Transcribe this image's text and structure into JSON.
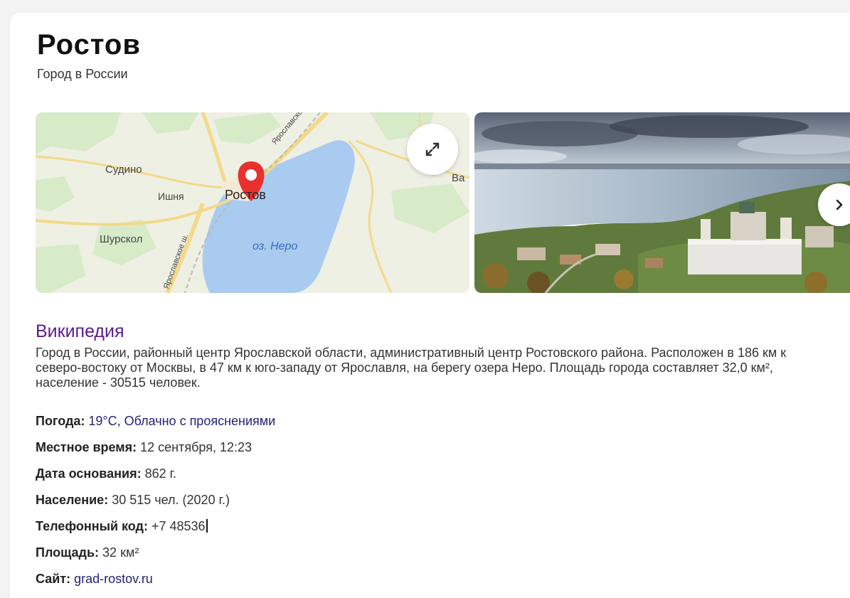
{
  "entity": {
    "title": "Ростов",
    "subtitle": "Город в России"
  },
  "map": {
    "labels": {
      "sudino": "Судино",
      "ishnya": "Ишня",
      "rostov": "Ростов",
      "shurskol": "Шурскол",
      "lake": "оз. Неро",
      "va": "Ва",
      "road_top": "Ярославское ш.",
      "road_bottom": "Ярославское ш."
    },
    "colors": {
      "land": "#eef0e4",
      "forest": "#d8ebc9",
      "water": "#a9cbf0",
      "road": "#f3d98a",
      "pin": "#e8312f"
    }
  },
  "photo": {
    "alt": "Ростов — вид сверху"
  },
  "wiki": {
    "link": "Википедия",
    "description": "Город в России, районный центр Ярославской области, административный центр Ростовского района. Расположен в 186 км к северо-востоку от Москвы, в 47 км к юго-западу от Ярославля, на берегу озера Неро. Площадь города составляет 32,0 км², население - 30515 человек."
  },
  "facts": [
    {
      "key": "Погода:",
      "value": " 19°C, Облачно с прояснениями",
      "link": true
    },
    {
      "key": "Местное время:",
      "value": " 12 сентября, 12:23",
      "link": false
    },
    {
      "key": "Дата основания:",
      "value": " 862 г.",
      "link": false
    },
    {
      "key": "Население:",
      "value": " 30 515 чел. (2020 г.)",
      "link": false
    },
    {
      "key": "Телефонный код:",
      "value": " +7 48536",
      "link": false
    },
    {
      "key": "Площадь:",
      "value": " 32 км²",
      "link": false
    },
    {
      "key": "Сайт:",
      "value": " grad-rostov.ru",
      "link": true
    }
  ]
}
